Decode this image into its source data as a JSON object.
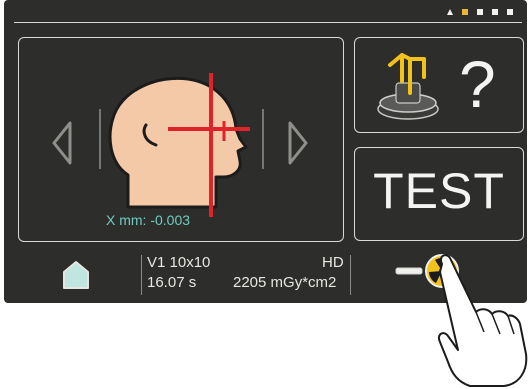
{
  "indicators": {
    "page_dots": [
      "triangle",
      "active",
      "inactive",
      "inactive",
      "inactive"
    ],
    "accent": "#e8b73a"
  },
  "positioning": {
    "x_label": "X mm:",
    "x_value": "-0.003",
    "prev_icon": "chevron-left-icon",
    "next_icon": "chevron-right-icon",
    "head_icon": "head-profile-icon",
    "crosshair_color": "#e0222a"
  },
  "help": {
    "icon": "bite-block-icon",
    "symbol": "?"
  },
  "test": {
    "label": "TEST"
  },
  "status": {
    "program": "V1 10x10",
    "quality": "HD",
    "time": "16.07 s",
    "dose": "2205 mGy*cm2"
  },
  "bottom": {
    "home_icon": "home-icon",
    "exposure_icon": "radiation-exposure-icon"
  },
  "colors": {
    "screen_bg": "#2d2d2b",
    "text_teal": "#6ecdbf",
    "radiation_yellow": "#f2c21b"
  }
}
